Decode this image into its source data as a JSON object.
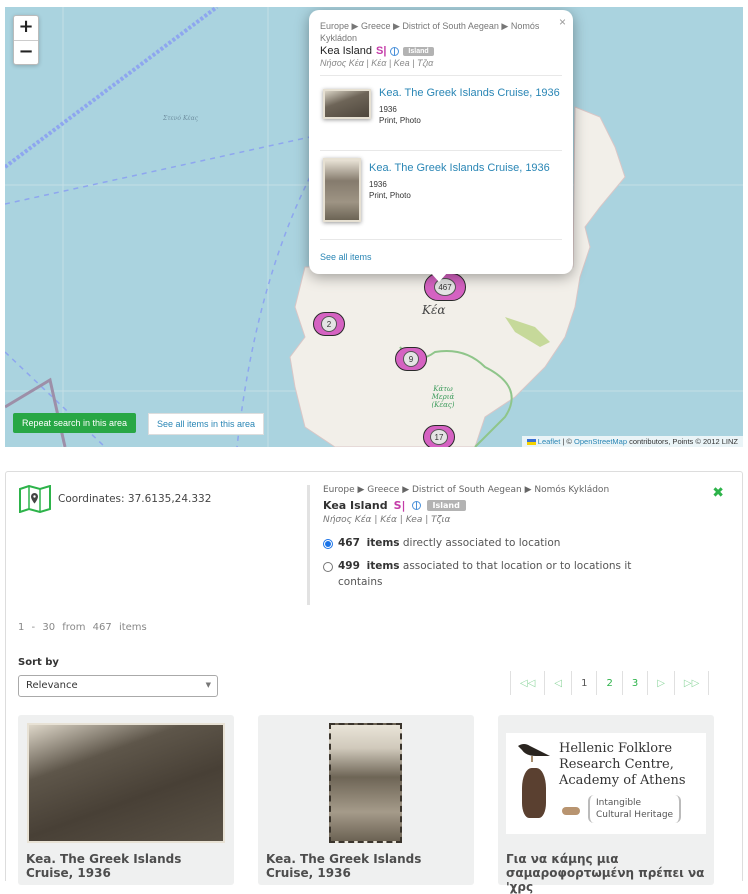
{
  "map": {
    "zoom_in": "+",
    "zoom_out": "−",
    "sea_label": "Στενό Κέας",
    "island_label": "Κέα",
    "region_label": "Κάτω Μεριά (Κέας)",
    "clusters": [
      {
        "count": "467"
      },
      {
        "count": "2"
      },
      {
        "count": "9"
      },
      {
        "count": "17"
      }
    ],
    "repeat_search": "Repeat search in this area",
    "see_all_area": "See all items in this area",
    "attribution": {
      "leaflet": "Leaflet",
      "sep": " | © ",
      "osm": "OpenStreetMap",
      "rest": " contributors, Points © 2012 LINZ"
    },
    "popup": {
      "close": "×",
      "breadcrumb": "Europe ▶ Greece ▶ District of South Aegean ▶ Nomós Kykládon",
      "place": "Kea Island",
      "s_icon": "S|",
      "badge": "Island",
      "alt_names": "Νήσος Κέα | Κέα | Kea | Τζια",
      "items": [
        {
          "title": "Kea. The Greek Islands Cruise, 1936",
          "year": "1936",
          "type": "Print, Photo"
        },
        {
          "title": "Kea. The Greek Islands Cruise, 1936",
          "year": "1936",
          "type": "Print, Photo"
        }
      ],
      "see_all": "See all items"
    }
  },
  "panel": {
    "coordinates": "Coordinates: 37.6135,24.332",
    "breadcrumb": "Europe ▶ Greece ▶ District of South Aegean ▶ Nomós Kykládon",
    "place": "Kea Island",
    "s_icon": "S|",
    "badge": "Island",
    "alt_names": "Νήσος Κέα | Κέα | Kea | Τζια",
    "close": "✖",
    "options": [
      {
        "count": "467",
        "items": "items",
        "text": " directly associated to location",
        "selected": true
      },
      {
        "count": "499",
        "items": "items",
        "text": " associated to that location or to locations it contains",
        "selected": false
      }
    ],
    "range": "1 - 30 from 467 items",
    "sort_label": "Sort by",
    "sort_value": "Relevance",
    "pagination": [
      "◁◁",
      "◁",
      "1",
      "2",
      "3",
      "▷",
      "▷▷"
    ],
    "current_page": "1",
    "cards": [
      {
        "title": "Kea. The Greek Islands Cruise, 1936"
      },
      {
        "title": "Kea. The Greek Islands Cruise, 1936"
      },
      {
        "title": "Για να κάμης μια σαμαροφορτωμένη πρέπει να 'χρς"
      }
    ],
    "logo": {
      "line1": "Hellenic Folklore",
      "line2": "Research Centre,",
      "line3": "Academy of Athens",
      "sub1": "Intangible",
      "sub2": "Cultural Heritage"
    }
  }
}
